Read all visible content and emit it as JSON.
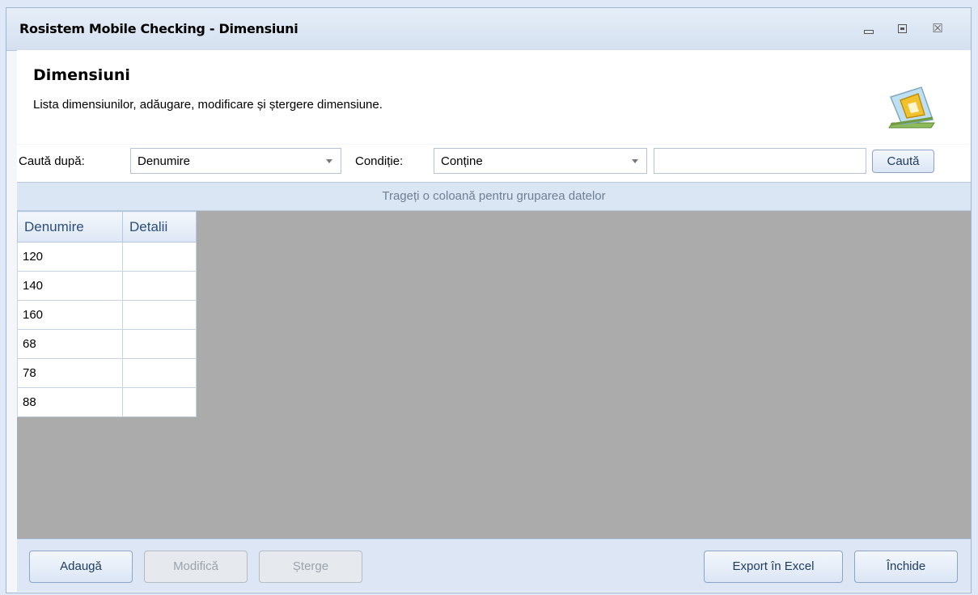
{
  "window": {
    "title": "Rosistem Mobile Checking - Dimensiuni",
    "close_glyph": "☒"
  },
  "header": {
    "title": "Dimensiuni",
    "description": "Lista dimensiunilor, adăugare, modificare și ștergere dimensiune.",
    "icon": "ruler-triangle-icon"
  },
  "search": {
    "search_by_label": "Caută după:",
    "search_by_value": "Denumire",
    "condition_label": "Condiție:",
    "condition_value": "Conține",
    "query_value": "",
    "search_button": "Caută"
  },
  "grid": {
    "group_hint": "Trageți o coloană pentru gruparea datelor",
    "columns": [
      "Denumire",
      "Detalii"
    ],
    "rows": [
      [
        "120",
        ""
      ],
      [
        "140",
        ""
      ],
      [
        "160",
        ""
      ],
      [
        "68",
        ""
      ],
      [
        "78",
        ""
      ],
      [
        "88",
        ""
      ]
    ]
  },
  "footer": {
    "add": "Adaugă",
    "modify": "Modifică",
    "delete": "Șterge",
    "export": "Export în Excel",
    "close": "Închide"
  },
  "colors": {
    "accent": "#2b4e7a",
    "grid_background": "#ababab"
  }
}
